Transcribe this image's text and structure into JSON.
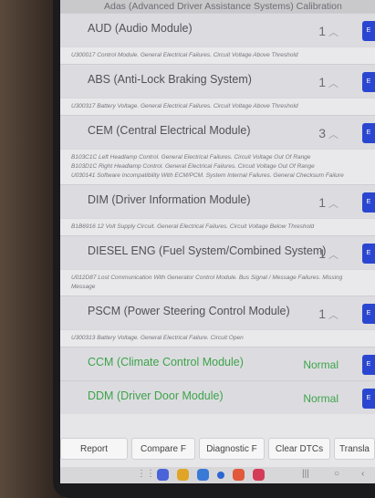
{
  "banner": {
    "text": "Adas (Advanced Driver Assistance Systems) Calibration"
  },
  "modules": [
    {
      "name": "AUD (Audio Module)",
      "count": "1",
      "dtcs": [
        "U300017 Control Module. General Electrical Failures. Circuit Voltage Above Threshold"
      ]
    },
    {
      "name": "ABS (Anti-Lock Braking System)",
      "count": "1",
      "dtcs": [
        "U300317 Battery Voltage. General Electrical Failures. Circuit Voltage Above Threshold"
      ]
    },
    {
      "name": "CEM (Central Electrical Module)",
      "count": "3",
      "dtcs": [
        "B103C1C Left Headlamp Control. General Electrical Failures. Circuit Voltage Out Of Range",
        "B103D1C Right Headlamp Control. General Electrical Failures. Circuit Voltage Out Of Range",
        "U030141 Software Incompatibility With ECM/PCM. System Internal Failures. General Checksum Failure"
      ]
    },
    {
      "name": "DIM (Driver Information Module)",
      "count": "1",
      "dtcs": [
        "B1B6916 12 Volt Supply Circuit. General Electrical Failures. Circuit Voltage Below Threshold"
      ]
    },
    {
      "name": "DIESEL ENG (Fuel System/Combined System)",
      "count": "1",
      "dtcs": [
        "U012D87 Lost Communication With Generator Control Module. Bus Signal / Message Failures. Missing Message"
      ]
    },
    {
      "name": "PSCM (Power Steering Control Module)",
      "count": "1",
      "dtcs": [
        "U300313 Battery Voltage. General Electrical Failure. Circuit Open"
      ]
    },
    {
      "name": "CCM (Climate Control Module)",
      "count": "Normal",
      "dtcs": []
    },
    {
      "name": "DDM (Driver Door Module)",
      "count": "Normal",
      "dtcs": []
    }
  ],
  "toolbar": {
    "report": "Report",
    "compare": "Compare F",
    "diagnostic": "Diagnostic F",
    "clear": "Clear DTCs",
    "translate": "Transla"
  },
  "navbar": {
    "apps_icon": "apps-grid-icon",
    "recent_icon": "recent-apps-icon",
    "home_icon": "home-icon",
    "back_icon": "back-icon"
  },
  "colors": {
    "accent": "#2a46d1",
    "ok": "#3da34a"
  }
}
